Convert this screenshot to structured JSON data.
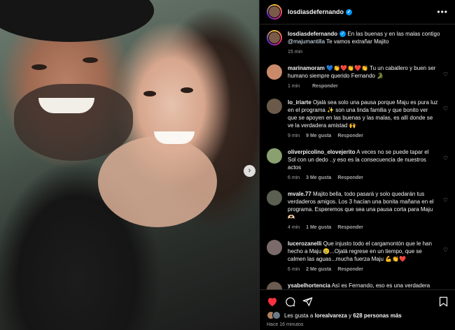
{
  "post": {
    "username": "losdiasdefernando",
    "caption_user": "losdiasdefernando",
    "caption_text": "En las buenas y en las malas contigo",
    "caption_mention": "@majumantilla",
    "caption_tail": "Te vamos extrañar Majito",
    "caption_time": "15 min"
  },
  "comments": [
    {
      "user": "marinamoram",
      "text": "💙👏❤️👏❤️👏 Tu un caballero y buen ser humano siempre querido Fernando 🐊",
      "time": "1 min",
      "likes": "",
      "reply": "Responder",
      "avatar_color": "#c98a6a"
    },
    {
      "user": "lo_iriarte",
      "text": "Ojalá sea solo una pausa porque Maju es pura luz en el programa ✨ son una linda familia y que bonito ver que se apoyen en las buenas y las malas, es allí donde se ve la verdadera amistad 🙌",
      "time": "9 min",
      "likes": "9 Me gusta",
      "reply": "Responder",
      "avatar_color": "#6b5a4a"
    },
    {
      "user": "oliverpicolino_elovejerito",
      "text": "A veces no se puede tapar el Sol con un dedo ..y eso es la consecuencia de nuestros actos",
      "time": "6 min",
      "likes": "3 Me gusta",
      "reply": "Responder",
      "avatar_color": "#8aa070"
    },
    {
      "user": "mvale.77",
      "text": "Majito bella, todo pasará y solo quedarán tus verdaderos amigos. Los 3 hacían una bonita mañana en el programa. Esperemos que sea una pausa corta para Maju 🫶🏻",
      "time": "4 min",
      "likes": "1 Me gusta",
      "reply": "Responder",
      "avatar_color": "#5a5f52"
    },
    {
      "user": "lucerozanelli",
      "text": "Que injusto todo el cargamontón que le han hecho a Maju 😢...Ojalá regrese en un tiempo, que se calmen las aguas...mucha fuerza Maju 💪👏❤️",
      "time": "6 min",
      "likes": "2 Me gusta",
      "reply": "Responder",
      "avatar_color": "#7a6a6a"
    },
    {
      "user": "ysabelhortencia",
      "text": "Así es Fernando, eso es una verdadera amistad!! Espero volver a ver a Majo en Arriba mi Gente ! La vamos a extrañar!",
      "time": "",
      "likes": "",
      "reply": "",
      "avatar_color": "#6a5a50"
    }
  ],
  "footer": {
    "likes_prefix": "Les gusta a",
    "likes_user": "lorealvareza",
    "likes_and": "y",
    "likes_count": "628 personas más",
    "time": "Hace 16 minutos"
  },
  "icons": {
    "more": "more-options-icon",
    "like": "heart-icon",
    "comment": "comment-icon",
    "share": "share-icon",
    "save": "bookmark-icon",
    "next": "chevron-right-icon"
  },
  "colors": {
    "accent": "#0095f6",
    "like": "#ff3040",
    "meta": "#a8a8a8"
  }
}
